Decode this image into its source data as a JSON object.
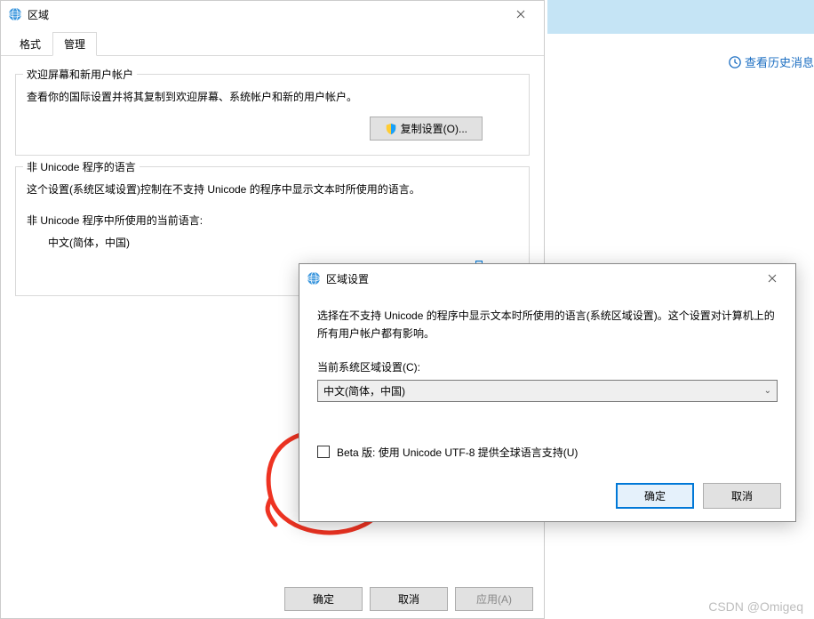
{
  "main": {
    "title": "区域",
    "tabs": {
      "format": "格式",
      "admin": "管理"
    },
    "group1": {
      "title": "欢迎屏幕和新用户帐户",
      "desc": "查看你的国际设置并将其复制到欢迎屏幕、系统帐户和新的用户帐户。",
      "copyBtn": "复制设置(O)..."
    },
    "group2": {
      "title": "非 Unicode 程序的语言",
      "desc": "这个设置(系统区域设置)控制在不支持 Unicode 的程序中显示文本时所使用的语言。",
      "langLabel": "非 Unicode 程序中所使用的当前语言:",
      "langValue": "中文(简体，中国)"
    },
    "buttons": {
      "ok": "确定",
      "cancel": "取消",
      "apply": "应用(A)"
    }
  },
  "historyLink": "查看历史消息",
  "modal": {
    "title": "区域设置",
    "desc": "选择在不支持 Unicode 的程序中显示文本时所使用的语言(系统区域设置)。这个设置对计算机上的所有用户帐户都有影响。",
    "localeLabel": "当前系统区域设置(C):",
    "localeValue": "中文(简体，中国)",
    "betaLabel": "Beta 版: 使用 Unicode UTF-8 提供全球语言支持(U)",
    "ok": "确定",
    "cancel": "取消"
  },
  "watermark": "CSDN @Omigeq"
}
